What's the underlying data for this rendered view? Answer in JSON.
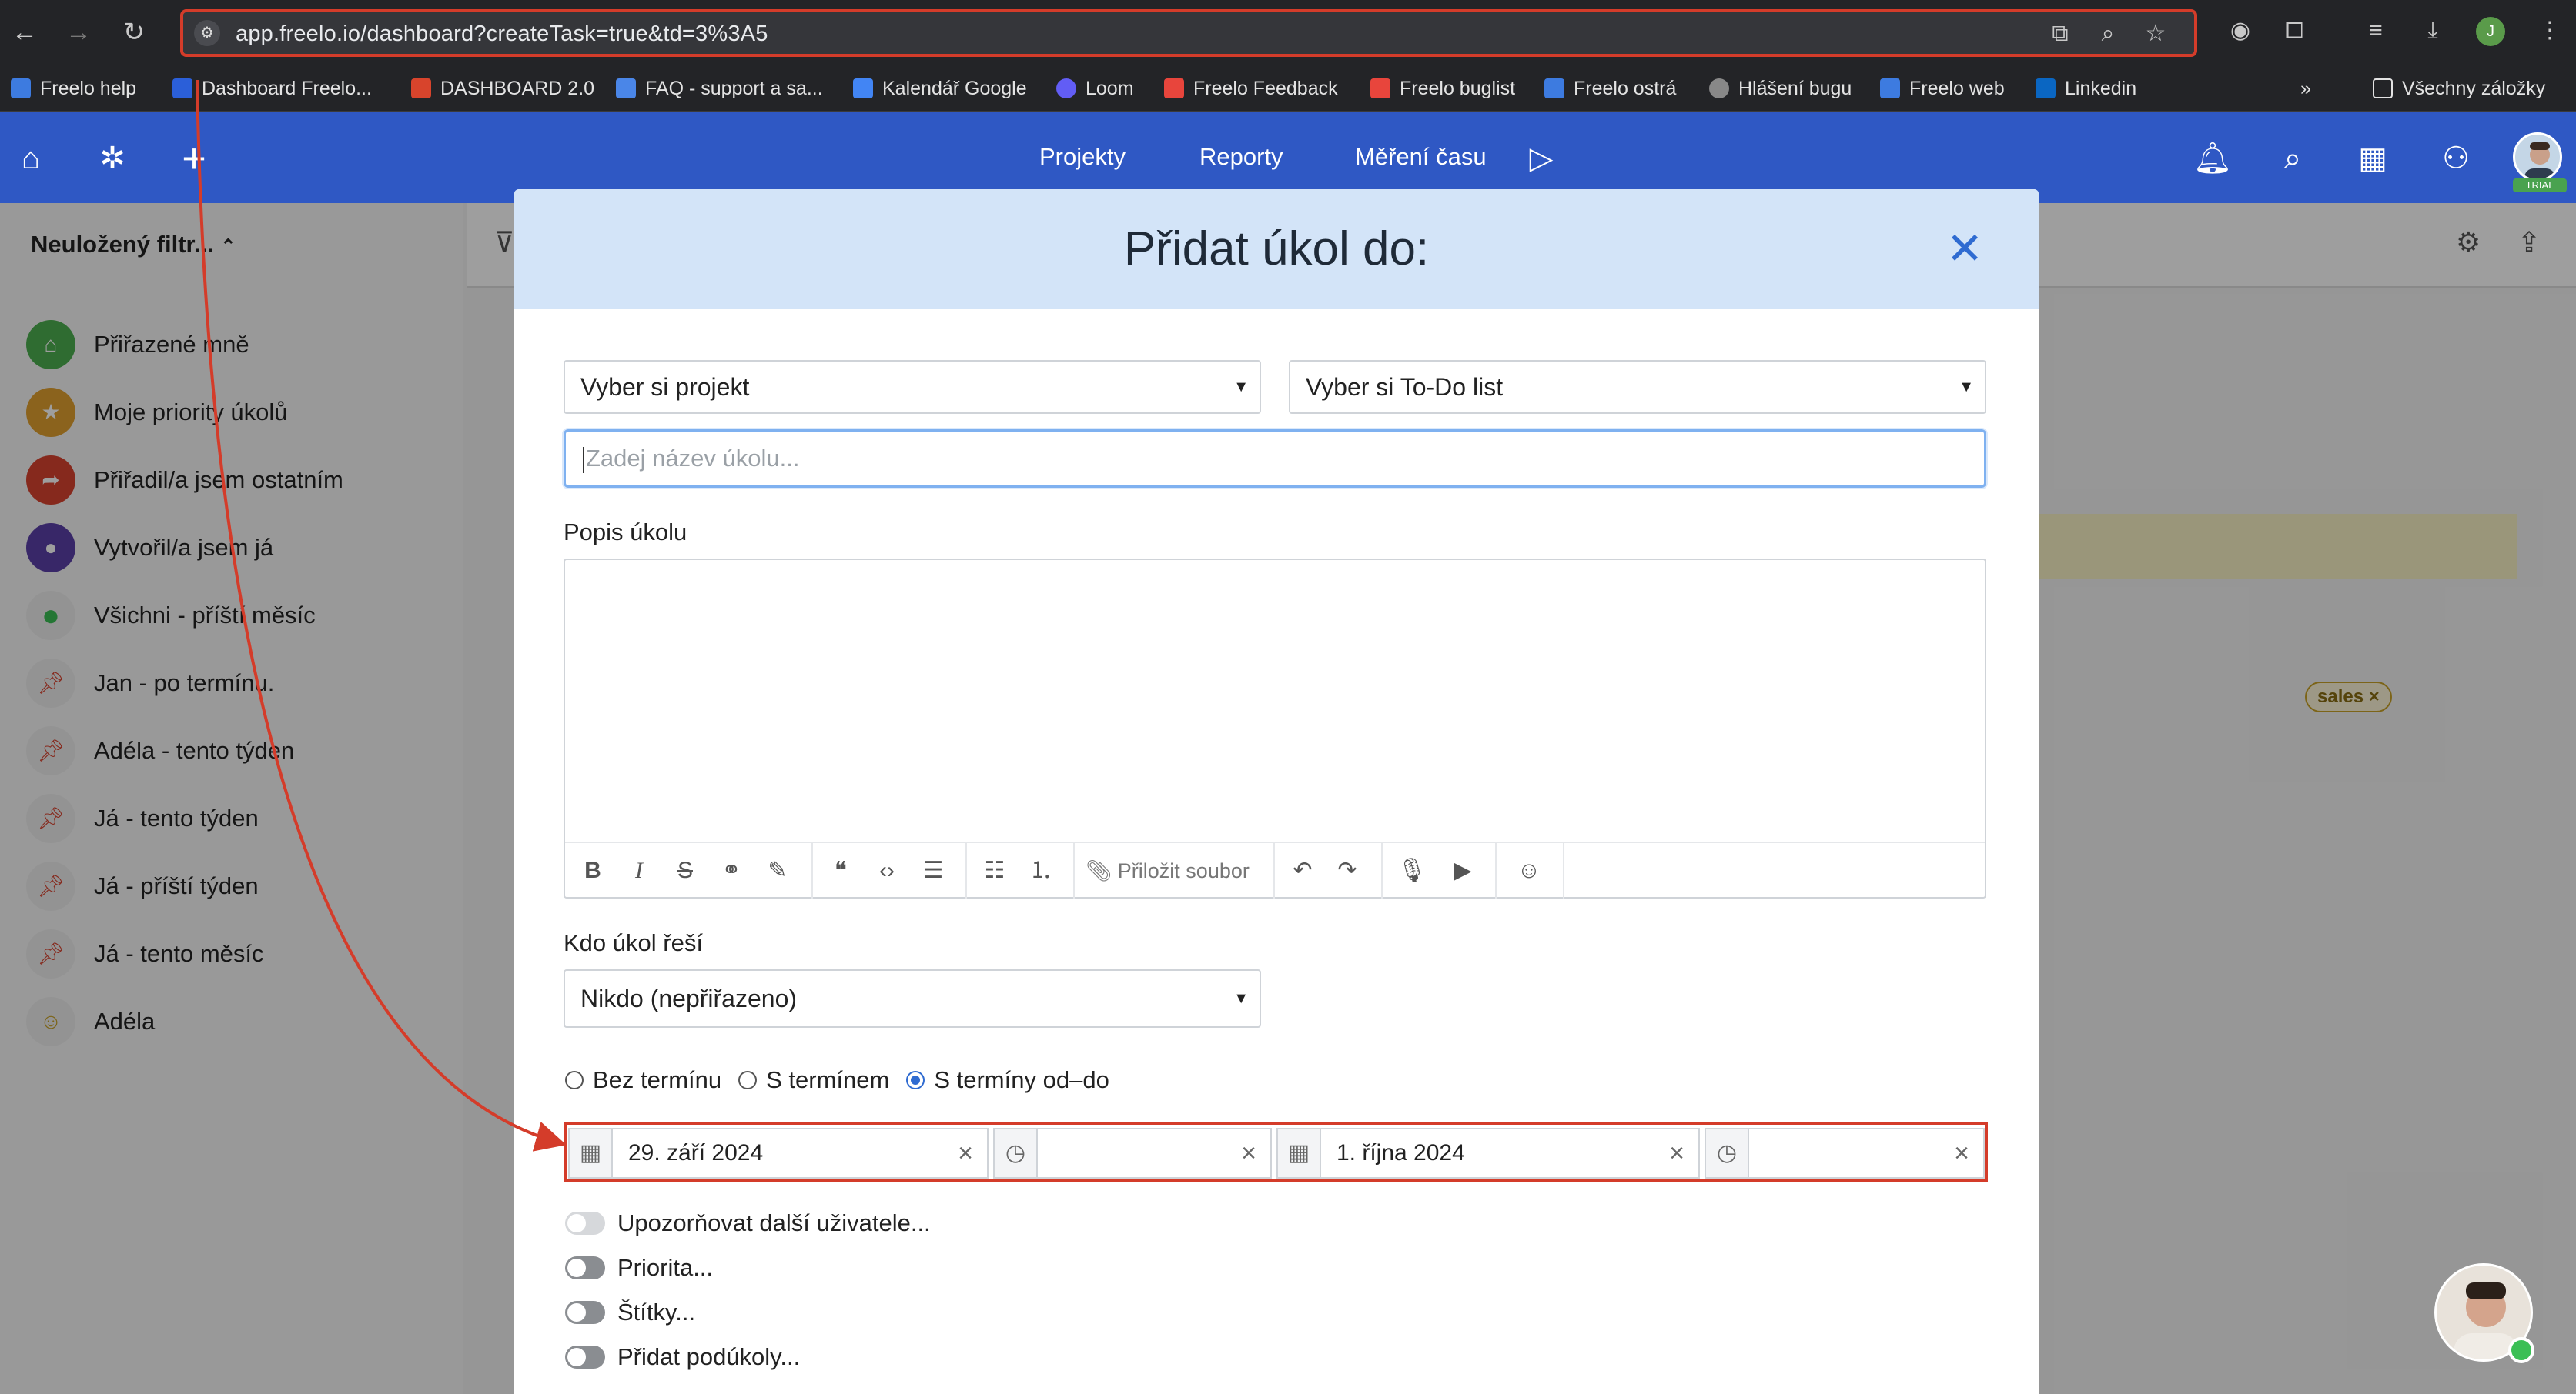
{
  "browser": {
    "url": "app.freelo.io/dashboard?createTask=true&td=3%3A5",
    "bookmarks": [
      {
        "label": "Freelo help",
        "color": "#3d7be0"
      },
      {
        "label": "Dashboard Freelo...",
        "color": "#2b5fd9"
      },
      {
        "label": "DASHBOARD 2.0",
        "color": "#d8442c"
      },
      {
        "label": "FAQ - support a sa...",
        "color": "#4a86e8"
      },
      {
        "label": "Kalendář Google",
        "color": "#4285f4"
      },
      {
        "label": "Loom",
        "color": "#625df5"
      },
      {
        "label": "Freelo Feedback",
        "color": "#e8453c"
      },
      {
        "label": "Freelo buglist",
        "color": "#e8453c"
      },
      {
        "label": "Freelo ostrá",
        "color": "#3d7be0"
      },
      {
        "label": "Hlášení bugu",
        "color": "#888888"
      },
      {
        "label": "Freelo web",
        "color": "#3d7be0"
      },
      {
        "label": "Linkedin",
        "color": "#0a66c2"
      }
    ],
    "all_bookmarks": "Všechny záložky",
    "profile_initial": "J"
  },
  "appnav": {
    "links": [
      "Projekty",
      "Reporty",
      "Měření času"
    ],
    "trial": "TRIAL"
  },
  "sidebar": {
    "filter_title": "Neuložený filtr...",
    "items": [
      {
        "label": "Přiřazené mně",
        "color": "#4caf50",
        "icon": "home-icon"
      },
      {
        "label": "Moje priority úkolů",
        "color": "#e0a030",
        "icon": "star-icon"
      },
      {
        "label": "Přiřadil/a jsem ostatním",
        "color": "#d9432f",
        "icon": "forward-icon"
      },
      {
        "label": "Vytvořil/a jsem já",
        "color": "#5b3fa8",
        "icon": "user-icon"
      },
      {
        "label": "Všichni - příští měsíc",
        "color": "#3bbf55",
        "icon": "green-dot-icon"
      },
      {
        "label": "Jan - po termínu.",
        "color": "#eeeeee",
        "icon": "pin-icon"
      },
      {
        "label": "Adéla - tento týden",
        "color": "#eeeeee",
        "icon": "pin-icon"
      },
      {
        "label": "Já - tento týden",
        "color": "#eeeeee",
        "icon": "pin-icon"
      },
      {
        "label": "Já - příští týden",
        "color": "#eeeeee",
        "icon": "pin-icon"
      },
      {
        "label": "Já - tento měsíc",
        "color": "#eeeeee",
        "icon": "pin-icon"
      },
      {
        "label": "Adéla",
        "color": "#eeeeee",
        "icon": "smiley-icon"
      }
    ]
  },
  "background": {
    "tag": "sales"
  },
  "modal": {
    "title": "Přidat úkol do:",
    "project_select": "Vyber si projekt",
    "todo_select": "Vyber si To-Do list",
    "task_placeholder": "Zadej název úkolu...",
    "description_label": "Popis úkolu",
    "attach_label": "Přiložit soubor",
    "assignee_label": "Kdo úkol řeší",
    "assignee_value": "Nikdo (nepřiřazeno)",
    "deadline_options": [
      "Bez termínu",
      "S termínem",
      "S termíny od–do"
    ],
    "deadline_selected": 2,
    "date_from": "29. září 2024",
    "time_from": "",
    "date_to": "1. října 2024",
    "time_to": "",
    "toggles": [
      "Upozorňovat další uživatele...",
      "Priorita...",
      "Štítky...",
      "Přidat podúkoly..."
    ]
  },
  "colors": {
    "accent": "#2f58c4",
    "highlight": "#d43c2a"
  }
}
